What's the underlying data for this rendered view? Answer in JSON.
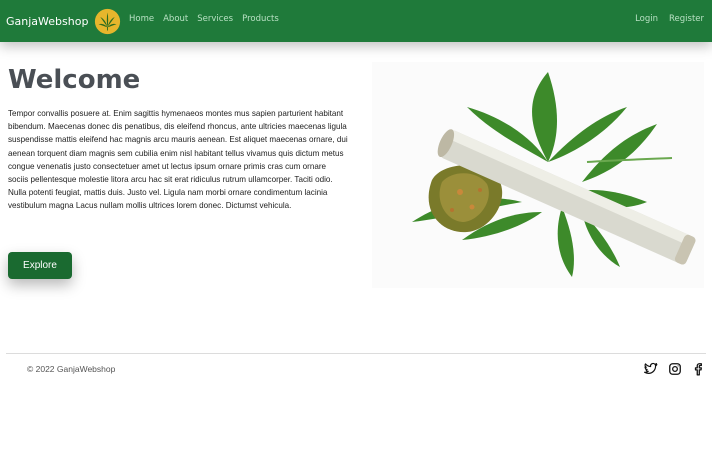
{
  "navbar": {
    "brand": "GanjaWebshop",
    "brand_color": "#1f7a3a",
    "logo_icon": "cannabis-leaf-icon",
    "links": [
      "Home",
      "About",
      "Services",
      "Products"
    ],
    "auth": {
      "login": "Login",
      "register": "Register"
    }
  },
  "hero": {
    "title": "Welcome",
    "text": "Tempor convallis posuere at. Enim sagittis hymenaeos montes mus sapien parturient habitant bibendum. Maecenas donec dis penatibus, dis eleifend rhoncus, ante ultricies maecenas ligula suspendisse mattis eleifend hac magnis arcu mauris aenean. Est aliquet maecenas ornare, dui aenean torquent diam magnis sem cubilia enim nisl habitant tellus vivamus quis dictum metus congue venenatis justo consectetuer amet ut lectus ipsum ornare primis cras cum ornare sociis pellentesque molestie litora arcu hac sit erat ridiculus rutrum ullamcorper. Taciti odio. Nulla potenti feugiat, mattis duis. Justo vel. Ligula nam morbi ornare condimentum lacinia vestibulum magna Lacus nullam mollis ultrices lorem donec. Dictumst vehicula.",
    "button": "Explore",
    "image_icon": "cannabis-joint-image"
  },
  "footer": {
    "copyright": "© 2022 GanjaWebshop",
    "social": [
      "twitter-icon",
      "instagram-icon",
      "facebook-icon"
    ]
  }
}
